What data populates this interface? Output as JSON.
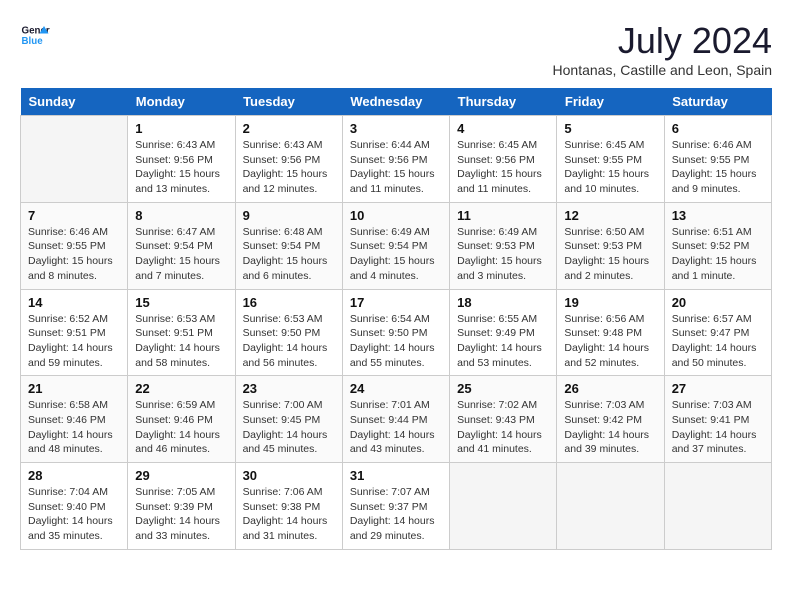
{
  "header": {
    "logo_line1": "General",
    "logo_line2": "Blue",
    "month_year": "July 2024",
    "location": "Hontanas, Castille and Leon, Spain"
  },
  "weekdays": [
    "Sunday",
    "Monday",
    "Tuesday",
    "Wednesday",
    "Thursday",
    "Friday",
    "Saturday"
  ],
  "weeks": [
    [
      {
        "day": "",
        "empty": true
      },
      {
        "day": "1",
        "sunrise": "6:43 AM",
        "sunset": "9:56 PM",
        "daylight": "15 hours and 13 minutes."
      },
      {
        "day": "2",
        "sunrise": "6:43 AM",
        "sunset": "9:56 PM",
        "daylight": "15 hours and 12 minutes."
      },
      {
        "day": "3",
        "sunrise": "6:44 AM",
        "sunset": "9:56 PM",
        "daylight": "15 hours and 11 minutes."
      },
      {
        "day": "4",
        "sunrise": "6:45 AM",
        "sunset": "9:56 PM",
        "daylight": "15 hours and 11 minutes."
      },
      {
        "day": "5",
        "sunrise": "6:45 AM",
        "sunset": "9:55 PM",
        "daylight": "15 hours and 10 minutes."
      },
      {
        "day": "6",
        "sunrise": "6:46 AM",
        "sunset": "9:55 PM",
        "daylight": "15 hours and 9 minutes."
      }
    ],
    [
      {
        "day": "7",
        "sunrise": "6:46 AM",
        "sunset": "9:55 PM",
        "daylight": "15 hours and 8 minutes."
      },
      {
        "day": "8",
        "sunrise": "6:47 AM",
        "sunset": "9:54 PM",
        "daylight": "15 hours and 7 minutes."
      },
      {
        "day": "9",
        "sunrise": "6:48 AM",
        "sunset": "9:54 PM",
        "daylight": "15 hours and 6 minutes."
      },
      {
        "day": "10",
        "sunrise": "6:49 AM",
        "sunset": "9:54 PM",
        "daylight": "15 hours and 4 minutes."
      },
      {
        "day": "11",
        "sunrise": "6:49 AM",
        "sunset": "9:53 PM",
        "daylight": "15 hours and 3 minutes."
      },
      {
        "day": "12",
        "sunrise": "6:50 AM",
        "sunset": "9:53 PM",
        "daylight": "15 hours and 2 minutes."
      },
      {
        "day": "13",
        "sunrise": "6:51 AM",
        "sunset": "9:52 PM",
        "daylight": "15 hours and 1 minute."
      }
    ],
    [
      {
        "day": "14",
        "sunrise": "6:52 AM",
        "sunset": "9:51 PM",
        "daylight": "14 hours and 59 minutes."
      },
      {
        "day": "15",
        "sunrise": "6:53 AM",
        "sunset": "9:51 PM",
        "daylight": "14 hours and 58 minutes."
      },
      {
        "day": "16",
        "sunrise": "6:53 AM",
        "sunset": "9:50 PM",
        "daylight": "14 hours and 56 minutes."
      },
      {
        "day": "17",
        "sunrise": "6:54 AM",
        "sunset": "9:50 PM",
        "daylight": "14 hours and 55 minutes."
      },
      {
        "day": "18",
        "sunrise": "6:55 AM",
        "sunset": "9:49 PM",
        "daylight": "14 hours and 53 minutes."
      },
      {
        "day": "19",
        "sunrise": "6:56 AM",
        "sunset": "9:48 PM",
        "daylight": "14 hours and 52 minutes."
      },
      {
        "day": "20",
        "sunrise": "6:57 AM",
        "sunset": "9:47 PM",
        "daylight": "14 hours and 50 minutes."
      }
    ],
    [
      {
        "day": "21",
        "sunrise": "6:58 AM",
        "sunset": "9:46 PM",
        "daylight": "14 hours and 48 minutes."
      },
      {
        "day": "22",
        "sunrise": "6:59 AM",
        "sunset": "9:46 PM",
        "daylight": "14 hours and 46 minutes."
      },
      {
        "day": "23",
        "sunrise": "7:00 AM",
        "sunset": "9:45 PM",
        "daylight": "14 hours and 45 minutes."
      },
      {
        "day": "24",
        "sunrise": "7:01 AM",
        "sunset": "9:44 PM",
        "daylight": "14 hours and 43 minutes."
      },
      {
        "day": "25",
        "sunrise": "7:02 AM",
        "sunset": "9:43 PM",
        "daylight": "14 hours and 41 minutes."
      },
      {
        "day": "26",
        "sunrise": "7:03 AM",
        "sunset": "9:42 PM",
        "daylight": "14 hours and 39 minutes."
      },
      {
        "day": "27",
        "sunrise": "7:03 AM",
        "sunset": "9:41 PM",
        "daylight": "14 hours and 37 minutes."
      }
    ],
    [
      {
        "day": "28",
        "sunrise": "7:04 AM",
        "sunset": "9:40 PM",
        "daylight": "14 hours and 35 minutes."
      },
      {
        "day": "29",
        "sunrise": "7:05 AM",
        "sunset": "9:39 PM",
        "daylight": "14 hours and 33 minutes."
      },
      {
        "day": "30",
        "sunrise": "7:06 AM",
        "sunset": "9:38 PM",
        "daylight": "14 hours and 31 minutes."
      },
      {
        "day": "31",
        "sunrise": "7:07 AM",
        "sunset": "9:37 PM",
        "daylight": "14 hours and 29 minutes."
      },
      {
        "day": "",
        "empty": true
      },
      {
        "day": "",
        "empty": true
      },
      {
        "day": "",
        "empty": true
      }
    ]
  ]
}
